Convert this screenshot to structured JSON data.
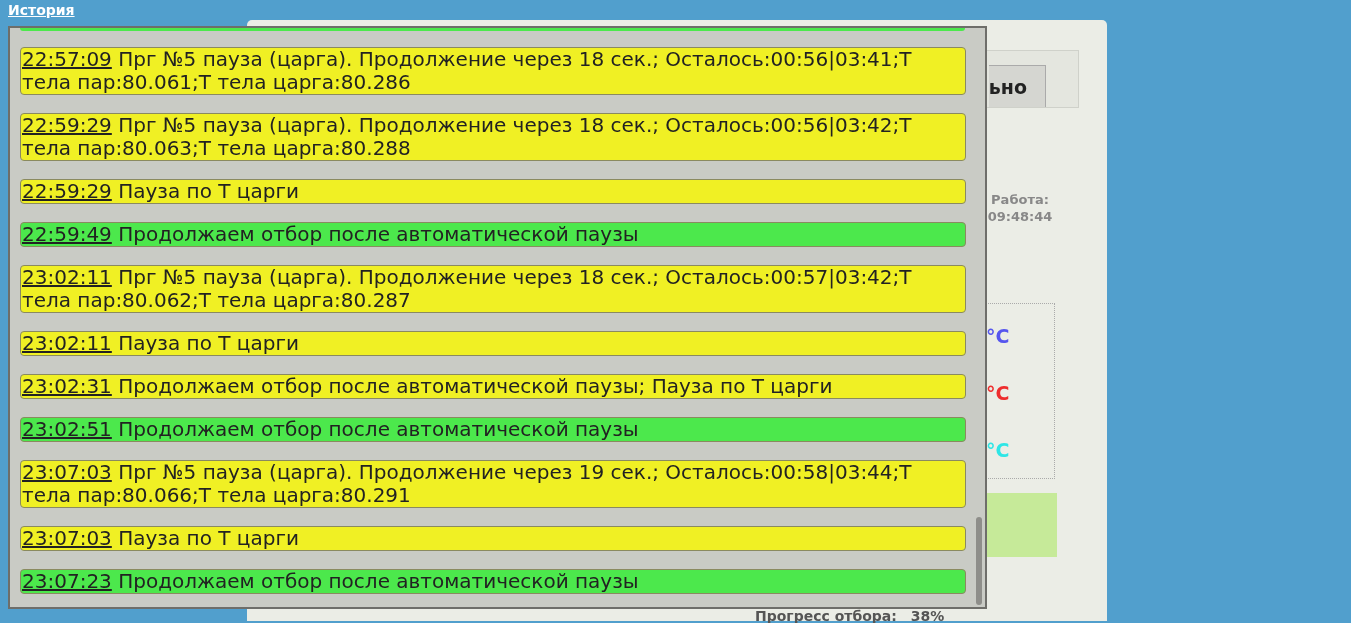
{
  "header_link": "История",
  "panel": {
    "tab_label": "ьно",
    "work_label": "Работа:",
    "work_time": "09:48:44",
    "temperature_units": [
      {
        "text": "°C",
        "color": "#5656ee"
      },
      {
        "text": "°C",
        "color": "#ee2e2e"
      },
      {
        "text": "°C",
        "color": "#2ee6e6"
      }
    ],
    "progress_label": "Прогресс отбора:",
    "progress_value": "38%"
  },
  "history": [
    {
      "time": "22:57:09",
      "text": "Прг №5 пауза (царга). Продолжение через 18 сек.; Осталось:00:56|03:41;Т тела пар:80.061;Т тела царга:80.286",
      "color": "#f0f024"
    },
    {
      "time": "22:59:29",
      "text": "Прг №5 пауза (царга). Продолжение через 18 сек.; Осталось:00:56|03:42;Т тела пар:80.063;Т тела царга:80.288",
      "color": "#f0f024"
    },
    {
      "time": "22:59:29",
      "text": "Пауза по Т царги",
      "color": "#f0f024"
    },
    {
      "time": "22:59:49",
      "text": "Продолжаем отбор после автоматической паузы",
      "color": "#4ce84c"
    },
    {
      "time": "23:02:11",
      "text": "Прг №5 пауза (царга). Продолжение через 18 сек.; Осталось:00:57|03:42;Т тела пар:80.062;Т тела царга:80.287",
      "color": "#f0f024"
    },
    {
      "time": "23:02:11",
      "text": "Пауза по Т царги",
      "color": "#f0f024"
    },
    {
      "time": "23:02:31",
      "text": "Продолжаем отбор после автоматической паузы; Пауза по Т царги",
      "color": "#f0f024"
    },
    {
      "time": "23:02:51",
      "text": "Продолжаем отбор после автоматической паузы",
      "color": "#4ce84c"
    },
    {
      "time": "23:07:03",
      "text": "Прг №5 пауза (царга). Продолжение через 19 сек.; Осталось:00:58|03:44;Т тела пар:80.066;Т тела царга:80.291",
      "color": "#f0f024"
    },
    {
      "time": "23:07:03",
      "text": "Пауза по Т царги",
      "color": "#f0f024"
    },
    {
      "time": "23:07:23",
      "text": "Продолжаем отбор после автоматической паузы",
      "color": "#4ce84c"
    }
  ]
}
